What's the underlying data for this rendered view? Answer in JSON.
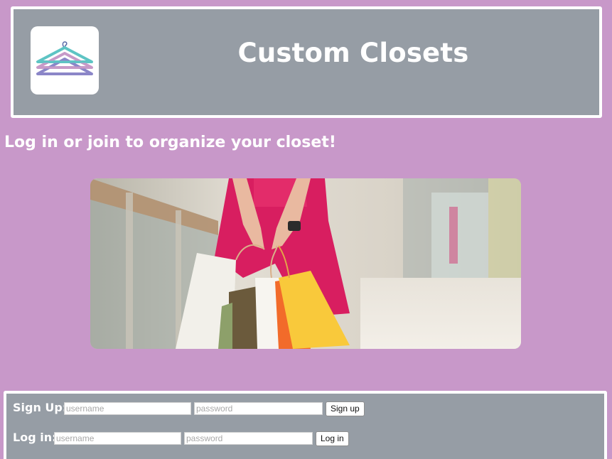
{
  "header": {
    "title": "Custom Closets",
    "logo_icon": "hanger-icon",
    "colors": {
      "background": "#969da5",
      "border": "#ffffff",
      "hanger_teal": "#5ec4c4",
      "hanger_pink": "#c79ac8",
      "hanger_purple": "#8b86c8"
    }
  },
  "tagline": "Log in or join to organize your closet!",
  "hero": {
    "icon": "shopping-bags-photo"
  },
  "signup": {
    "label": "Sign Up:",
    "username_placeholder": "username",
    "password_placeholder": "password",
    "button_label": "Sign up"
  },
  "login": {
    "label": "Log in:",
    "username_placeholder": "username",
    "password_placeholder": "password",
    "button_label": "Log in"
  },
  "colors": {
    "page_background": "#c898c9",
    "panel_background": "#969da5",
    "text": "#ffffff"
  }
}
